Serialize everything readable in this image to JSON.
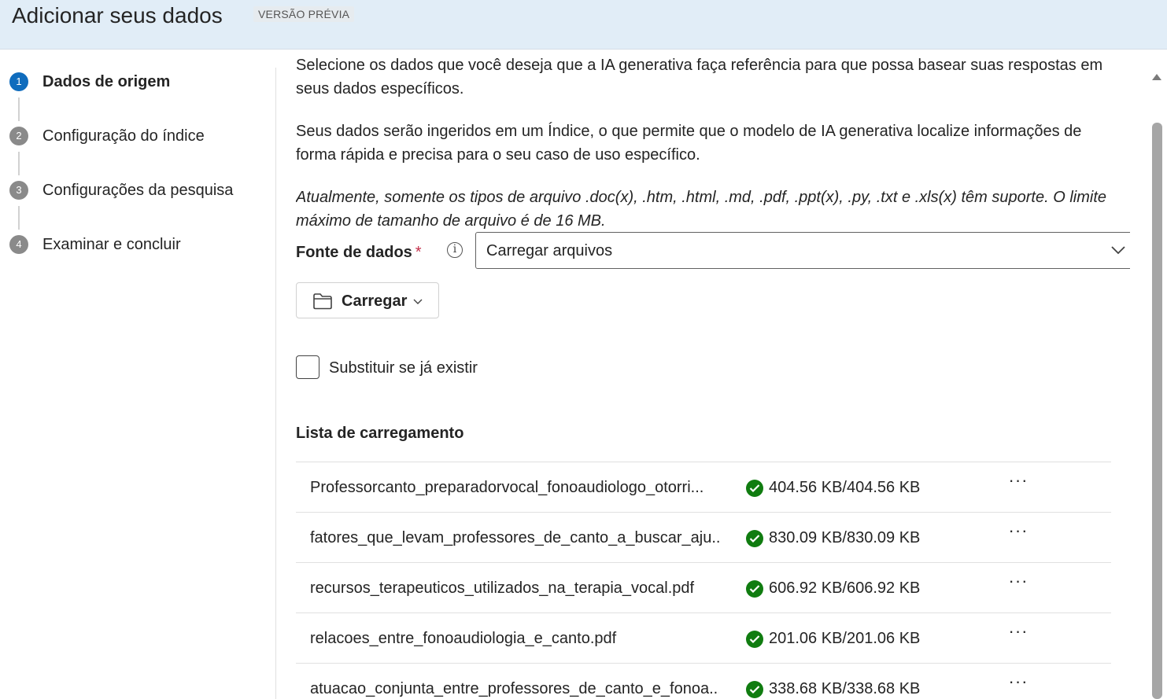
{
  "header": {
    "title": "Adicionar seus dados",
    "badge": "VERSÃO PRÉVIA"
  },
  "stepper": {
    "steps": [
      {
        "number": "1",
        "label": "Dados de origem",
        "active": true
      },
      {
        "number": "2",
        "label": "Configuração do índice",
        "active": false
      },
      {
        "number": "3",
        "label": "Configurações da pesquisa",
        "active": false
      },
      {
        "number": "4",
        "label": "Examinar e concluir",
        "active": false
      }
    ]
  },
  "content": {
    "intro": "Selecione os dados que você deseja que a IA generativa faça referência para que possa basear suas respostas em seus dados específicos.",
    "index_note": "Seus dados serão ingeridos em um Índice, o que permite que o modelo de IA generativa localize informações de forma rápida e precisa para o seu caso de uso específico.",
    "file_types_note": "Atualmente, somente os tipos de arquivo .doc(x), .htm, .html, .md, .pdf, .ppt(x), .py, .txt e .xls(x) têm suporte. O limite máximo de tamanho de arquivo é de 16 MB.",
    "data_source": {
      "label": "Fonte de dados",
      "required_mark": "*",
      "value": "Carregar arquivos",
      "icon": "info-icon"
    },
    "upload_button": {
      "label": "Carregar",
      "icon": "folder-icon"
    },
    "overwrite_checkbox": {
      "label": "Substituir se já existir",
      "checked": false
    },
    "upload_list": {
      "title": "Lista de carregamento",
      "files": [
        {
          "name": "Professorcanto_preparadorvocal_fonoaudiologo_otorri...",
          "size": "404.56 KB/404.56 KB",
          "status": "success"
        },
        {
          "name": "fatores_que_levam_professores_de_canto_a_buscar_aju...",
          "size": "830.09 KB/830.09 KB",
          "status": "success"
        },
        {
          "name": "recursos_terapeuticos_utilizados_na_terapia_vocal.pdf",
          "size": "606.92 KB/606.92 KB",
          "status": "success"
        },
        {
          "name": "relacoes_entre_fonoaudiologia_e_canto.pdf",
          "size": "201.06 KB/201.06 KB",
          "status": "success"
        },
        {
          "name": "atuacao_conjunta_entre_professores_de_canto_e_fonoa...",
          "size": "338.68 KB/338.68 KB",
          "status": "success"
        }
      ],
      "more_label": "···"
    }
  },
  "colors": {
    "header_bg": "#e1edf7",
    "active_step": "#0f6cbd",
    "success": "#107c10",
    "required": "#c4314b"
  }
}
